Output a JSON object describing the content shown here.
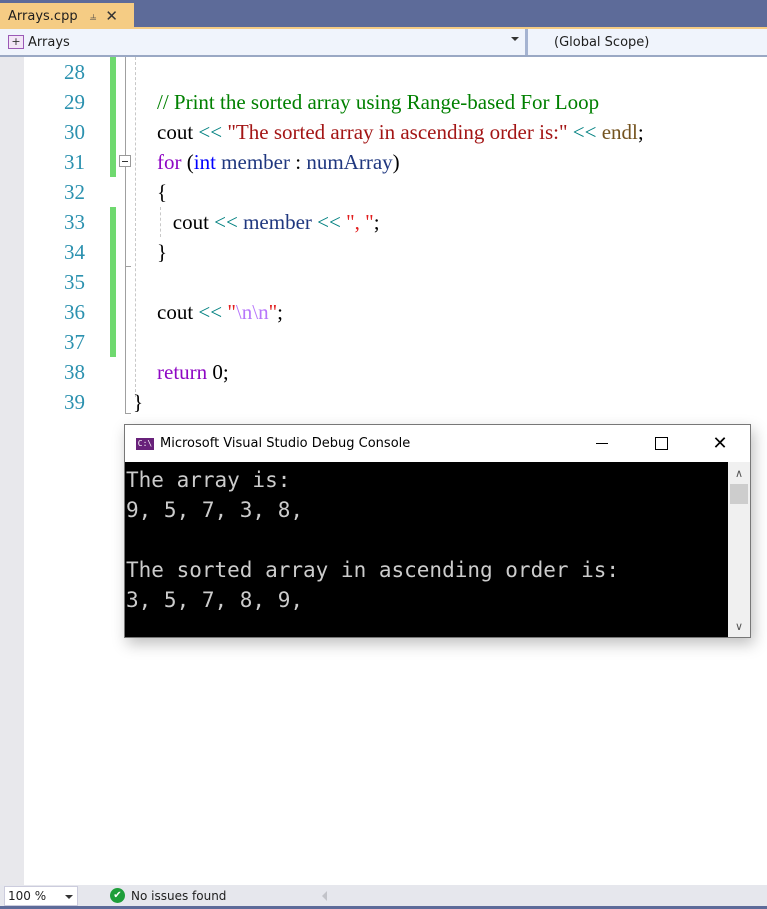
{
  "tab": {
    "title": "Arrays.cpp",
    "pin_icon": "pin-icon",
    "close_icon": "close-icon"
  },
  "navbar": {
    "project": "Arrays",
    "scope": "(Global Scope)"
  },
  "editor": {
    "line_numbers": [
      "28",
      "29",
      "30",
      "31",
      "32",
      "33",
      "34",
      "35",
      "36",
      "37",
      "38",
      "39"
    ],
    "lines": [
      {
        "n": "28",
        "tokens": []
      },
      {
        "n": "29",
        "tokens": [
          {
            "t": "// Print the sorted array using Range-based For Loop",
            "k": "comment"
          }
        ]
      },
      {
        "n": "30",
        "tokens": [
          {
            "t": "cout",
            "k": "plain"
          },
          {
            "t": " << ",
            "k": "op"
          },
          {
            "t": "\"The sorted array in ascending order is:\"",
            "k": "str"
          },
          {
            "t": " << ",
            "k": "op"
          },
          {
            "t": "endl",
            "k": "func"
          },
          {
            "t": ";",
            "k": "plain"
          }
        ]
      },
      {
        "n": "31",
        "tokens": [
          {
            "t": "for",
            "k": "kw"
          },
          {
            "t": " (",
            "k": "plain"
          },
          {
            "t": "int",
            "k": "type"
          },
          {
            "t": " member",
            "k": "var"
          },
          {
            "t": " : ",
            "k": "plain"
          },
          {
            "t": "numArray",
            "k": "var"
          },
          {
            "t": ")",
            "k": "plain"
          }
        ]
      },
      {
        "n": "32",
        "tokens": [
          {
            "t": "{",
            "k": "plain"
          }
        ]
      },
      {
        "n": "33",
        "tokens": [
          {
            "t": "   cout",
            "k": "plain"
          },
          {
            "t": " << ",
            "k": "op"
          },
          {
            "t": "member",
            "k": "var"
          },
          {
            "t": " << ",
            "k": "op"
          },
          {
            "t": "\", \"",
            "k": "red"
          },
          {
            "t": ";",
            "k": "plain"
          }
        ]
      },
      {
        "n": "34",
        "tokens": [
          {
            "t": "}",
            "k": "plain"
          }
        ]
      },
      {
        "n": "35",
        "tokens": []
      },
      {
        "n": "36",
        "tokens": [
          {
            "t": "cout",
            "k": "plain"
          },
          {
            "t": " << ",
            "k": "op"
          },
          {
            "t": "\"",
            "k": "red"
          },
          {
            "t": "\\n\\n",
            "k": "esc"
          },
          {
            "t": "\"",
            "k": "red"
          },
          {
            "t": ";",
            "k": "plain"
          }
        ]
      },
      {
        "n": "37",
        "tokens": []
      },
      {
        "n": "38",
        "tokens": [
          {
            "t": "return",
            "k": "kw"
          },
          {
            "t": " 0;",
            "k": "plain"
          }
        ]
      },
      {
        "n": "39",
        "tokens": [
          {
            "t": "}",
            "k": "plain",
            "outdent": true
          }
        ]
      }
    ]
  },
  "console": {
    "title": "Microsoft Visual Studio Debug Console",
    "icon_label": "C:\\",
    "output": [
      "The array is:",
      "9, 5, 7, 3, 8,",
      "",
      "The sorted array in ascending order is:",
      "3, 5, 7, 8, 9,"
    ]
  },
  "statusbar": {
    "zoom": "100 %",
    "status": "No issues found"
  }
}
